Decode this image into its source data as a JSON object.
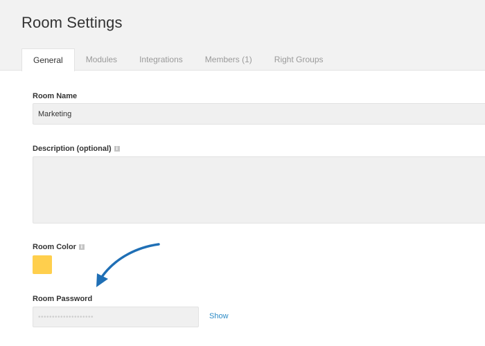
{
  "header": {
    "title": "Room Settings",
    "tabs": [
      {
        "label": "General",
        "active": true
      },
      {
        "label": "Modules",
        "active": false
      },
      {
        "label": "Integrations",
        "active": false
      },
      {
        "label": "Members (1)",
        "active": false
      },
      {
        "label": "Right Groups",
        "active": false
      }
    ]
  },
  "form": {
    "room_name": {
      "label": "Room Name",
      "value": "Marketing"
    },
    "description": {
      "label": "Description (optional)",
      "value": "",
      "info_icon": "info-icon"
    },
    "room_color": {
      "label": "Room Color",
      "color": "#ffcf4d",
      "info_icon": "info-icon"
    },
    "room_password": {
      "label": "Room Password",
      "masked_value": "••••••••••••••••••••",
      "show_label": "Show"
    }
  },
  "annotation": {
    "arrow_color": "#1f6fb5"
  },
  "colors": {
    "link": "#2b8ac6",
    "header_bg": "#f2f2f2",
    "input_bg": "#f0f0f0"
  }
}
